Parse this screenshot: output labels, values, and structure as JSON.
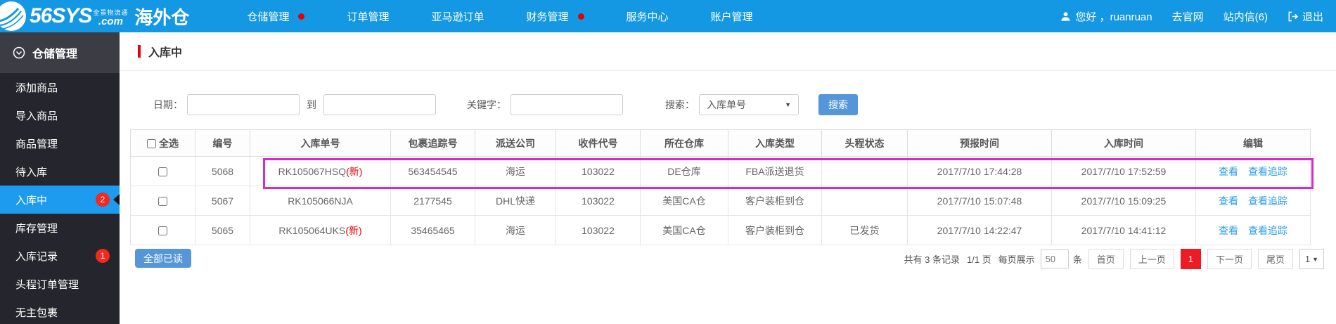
{
  "topbar": {
    "brand": "56SYS",
    "brand_suffix": ".com",
    "slogan": "全景物流通",
    "product": "海外仓",
    "nav": [
      {
        "label": "仓储管理",
        "dot": true
      },
      {
        "label": "订单管理",
        "dot": false
      },
      {
        "label": "亚马逊订单",
        "dot": false
      },
      {
        "label": "财务管理",
        "dot": true
      },
      {
        "label": "服务中心",
        "dot": false
      },
      {
        "label": "账户管理",
        "dot": false
      }
    ],
    "greeting": "您好 ，ruanruan",
    "official_site": "去官网",
    "inbox": "站内信(6)",
    "logout": "退出"
  },
  "sidebar": {
    "header": "仓储管理",
    "items": [
      {
        "label": "添加商品",
        "badge": ""
      },
      {
        "label": "导入商品",
        "badge": ""
      },
      {
        "label": "商品管理",
        "badge": ""
      },
      {
        "label": "待入库",
        "badge": ""
      },
      {
        "label": "入库中",
        "badge": "2"
      },
      {
        "label": "库存管理",
        "badge": ""
      },
      {
        "label": "入库记录",
        "badge": "1"
      },
      {
        "label": "头程订单管理",
        "badge": ""
      },
      {
        "label": "无主包裹",
        "badge": ""
      }
    ]
  },
  "page": {
    "title": "入库中",
    "filters": {
      "date_label": "日期：",
      "to_label": "到",
      "keyword_label": "关键字：",
      "search_by_label": "搜索：",
      "search_by_value": "入库单号",
      "search_button": "搜索"
    },
    "table": {
      "headers": [
        "全选",
        "编号",
        "入库单号",
        "包裹追踪号",
        "派送公司",
        "收件代号",
        "所在仓库",
        "入库类型",
        "头程状态",
        "预报时间",
        "入库时间",
        "编辑"
      ],
      "rows": [
        {
          "id": "5068",
          "order_no": "RK105067HSQ",
          "new_tag": "(新)",
          "tracking_no": "563454545",
          "carrier": "海运",
          "recipient_code": "103022",
          "warehouse": "DE仓库",
          "inbound_type": "FBA派送退货",
          "first_leg_status": "",
          "forecast_time": "2017/7/10 17:44:28",
          "inbound_time": "2017/7/10 17:52:59",
          "view": "查看",
          "view_tracking": "查看追踪"
        },
        {
          "id": "5067",
          "order_no": "RK105066NJA",
          "new_tag": "",
          "tracking_no": "2177545",
          "carrier": "DHL快递",
          "recipient_code": "103022",
          "warehouse": "美国CA仓",
          "inbound_type": "客户装柜到仓",
          "first_leg_status": "",
          "forecast_time": "2017/7/10 15:07:48",
          "inbound_time": "2017/7/10 15:09:25",
          "view": "查看",
          "view_tracking": "查看追踪"
        },
        {
          "id": "5065",
          "order_no": "RK105064UKS",
          "new_tag": "(新)",
          "tracking_no": "35465465",
          "carrier": "海运",
          "recipient_code": "103022",
          "warehouse": "美国CA仓",
          "inbound_type": "客户装柜到仓",
          "first_leg_status": "已发货",
          "forecast_time": "2017/7/10 14:22:47",
          "inbound_time": "2017/7/10 14:41:12",
          "view": "查看",
          "view_tracking": "查看追踪"
        }
      ]
    },
    "mark_all_read_button": "全部已读",
    "pagination": {
      "total_text": "共有 3 条记录",
      "page_text": "1/1 页",
      "per_page_label": "每页展示",
      "per_page_value": "50",
      "unit_label": "条",
      "first": "首页",
      "prev": "上一页",
      "current": "1",
      "next": "下一页",
      "last": "尾页",
      "page_select_value": "1"
    }
  },
  "colors": {
    "topbar_blue": "#1598e3",
    "sidebar_dark": "#25252d",
    "active_item_blue": "#1c9bef",
    "badge_red": "#f3281e",
    "highlight_magenta": "#d72bc8",
    "button_blue": "#5596d9",
    "link_blue": "#2a9ee8",
    "current_page_red": "#ed1c24",
    "title_bar_red": "#e60012"
  }
}
